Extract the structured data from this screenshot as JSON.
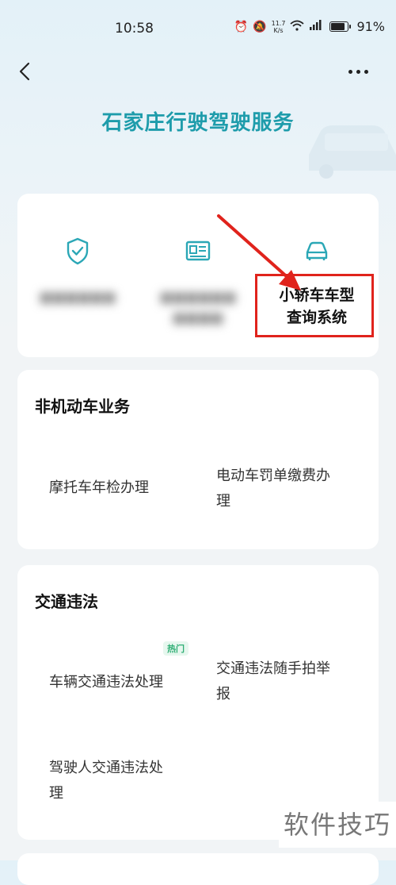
{
  "status_bar": {
    "time": "10:58",
    "net_speed_value": "11.7",
    "net_speed_unit": "K/s",
    "battery_pct": "91%",
    "battery_level": 0.91
  },
  "nav": {
    "back_icon": "chevron-left-icon",
    "more_icon": "more-horizontal-icon"
  },
  "hero": {
    "title": "石家庄行驶驾驶服务"
  },
  "quick_access": {
    "items": [
      {
        "icon": "shield-check-icon"
      },
      {
        "icon": "id-card-icon"
      },
      {
        "icon": "car-icon"
      }
    ],
    "annotation_label_line1": "小轿车车型",
    "annotation_label_line2": "查询系统",
    "annotation_color": "#e0231c"
  },
  "section_nonmotor": {
    "title": "非机动车业务",
    "items": [
      {
        "label": "摩托车年检办理"
      },
      {
        "label_line1": "电动车罚单缴费办",
        "label_line2": "理"
      }
    ]
  },
  "section_violation": {
    "title": "交通违法",
    "items": [
      {
        "label": "车辆交通违法处理",
        "badge": "热门"
      },
      {
        "label_line1": "交通违法随手拍举",
        "label_line2": "报"
      },
      {
        "label_line1": "驾驶人交通违法处",
        "label_line2": "理"
      }
    ]
  },
  "watermark": "软件技巧",
  "colors": {
    "brand": "#1e9cab",
    "hot": "#2fae74",
    "annotation": "#e0231c"
  }
}
